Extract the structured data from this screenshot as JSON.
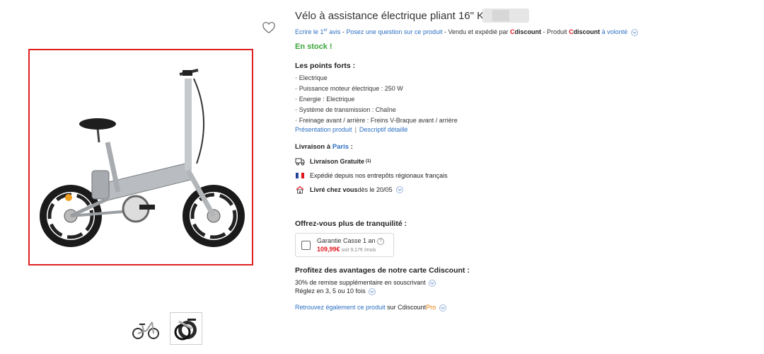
{
  "product": {
    "title": "Vélo à assistance électrique pliant 16\" K",
    "review_link": "Ecrire le 1",
    "review_sup": "er",
    "review_suffix": " avis",
    "dash1": " - ",
    "question_link": "Posez une question sur ce produit",
    "seller_text": " - Vendu et expédié par ",
    "brand_c": "C",
    "brand_rest": "discount",
    "product_text": " - Produit ",
    "volonte": " à volonté",
    "stock": "En stock !"
  },
  "highlights": {
    "title": "Les points forts :",
    "items": [
      "Electrique",
      "Puissance moteur électrique : 250 W",
      "Energie : Electrique",
      "Système de transmission : Chaîne",
      "Freinage avant / arrière : Freins V-Braque avant / arrière"
    ],
    "link_presentation": "Présentation produit",
    "link_separator": "|",
    "link_descriptif": "Descriptif détaillé"
  },
  "delivery": {
    "title_prefix": "Livraison à ",
    "city": "Paris",
    "title_suffix": " :",
    "free": "Livraison Gratuite",
    "free_sup": "(1)",
    "shipped_from": "Expédié depuis nos entrepôts régionaux français",
    "delivered_label": "Livré chez vous",
    "delivered_date": " dès le 20/05"
  },
  "warranty": {
    "title": "Offrez-vous plus de tranquilité :",
    "label": "Garantie Casse 1 an",
    "help": "?",
    "price": "109,99€",
    "monthly": " soit 9,17€ /mois"
  },
  "card": {
    "title": "Profitez des avantages de notre carte Cdiscount :",
    "line1": "30% de remise supplémentaire en souscrivant",
    "line2": "Réglez en 3, 5 ou 10 fois"
  },
  "pro": {
    "link": "Retrouvez également ce produit",
    "text": " sur Cdiscount",
    "pro": "Pro"
  },
  "colors": {
    "link_blue": "#2b6fc2",
    "brand_red": "#e2161e",
    "stock_green": "#3aa63a",
    "highlight_border": "#e02020",
    "pro_orange": "#e07b00"
  },
  "icons": [
    "heart-icon",
    "truck-icon",
    "france-flag-icon",
    "house-icon",
    "chevron-down-icon",
    "help-icon"
  ]
}
